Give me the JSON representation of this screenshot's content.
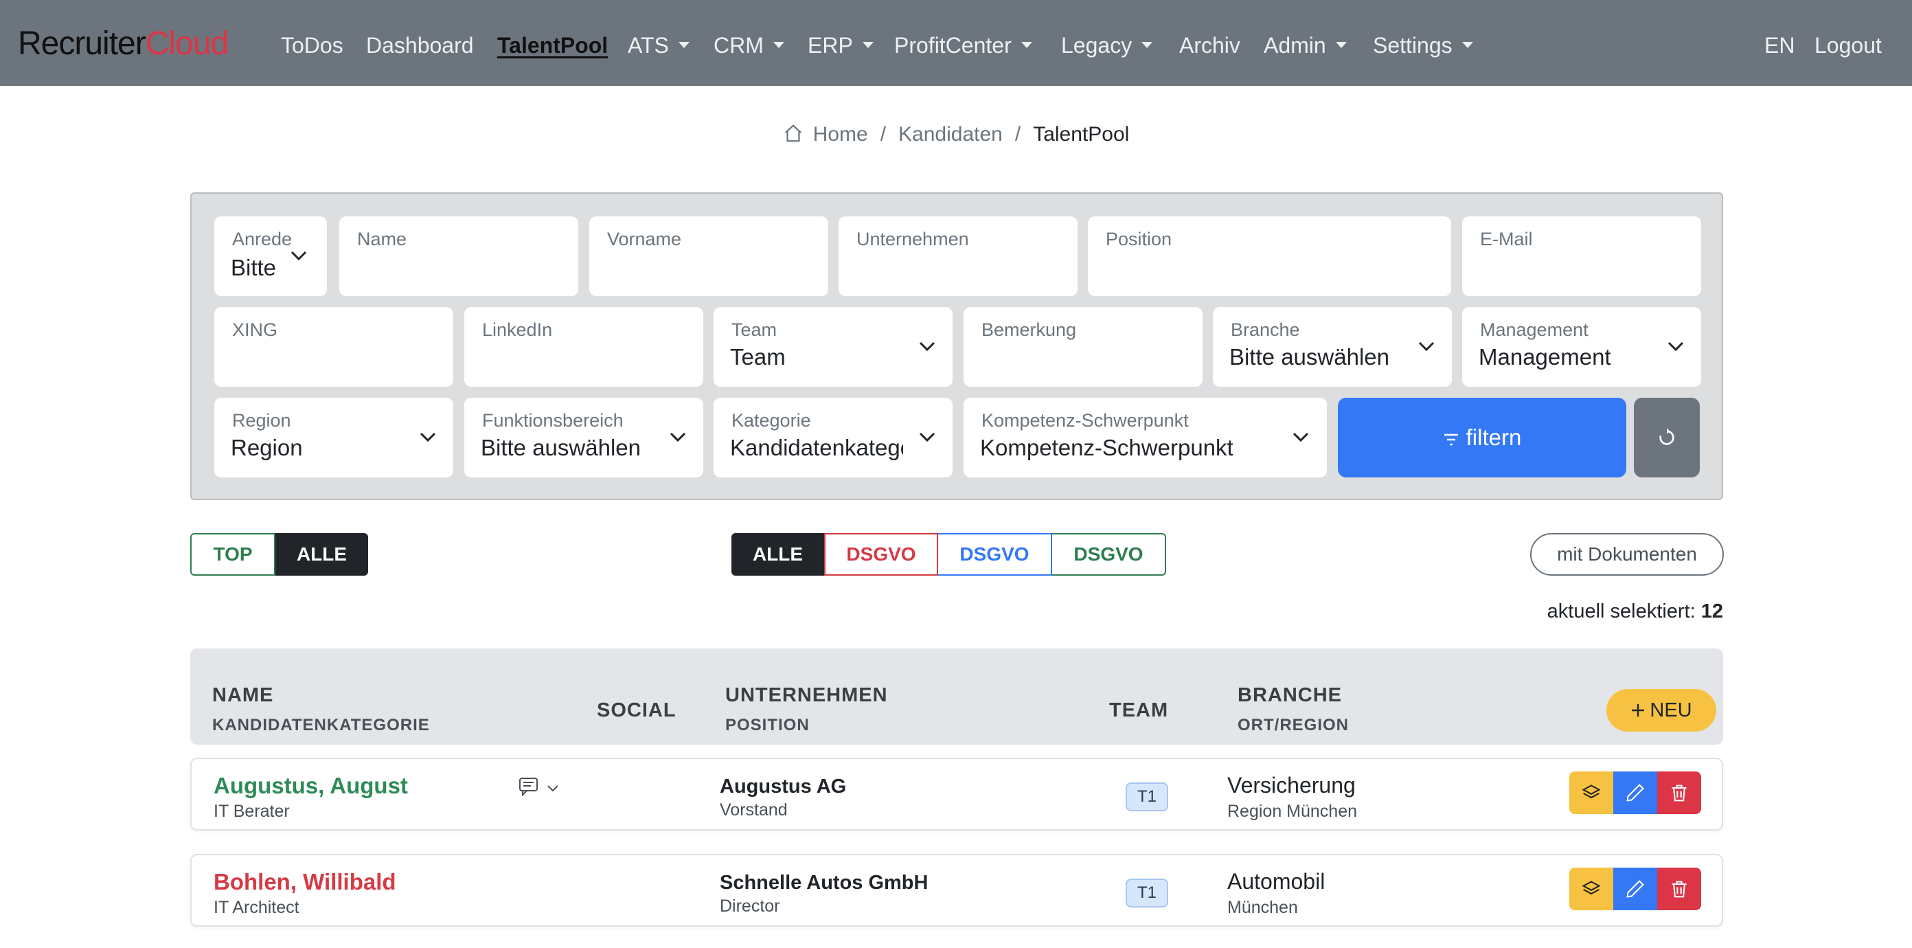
{
  "brand": {
    "part1": "Recruiter",
    "part2": "Cloud"
  },
  "nav": {
    "todos": "ToDos",
    "dashboard": "Dashboard",
    "talentpool": "TalentPool",
    "ats": "ATS",
    "crm": "CRM",
    "erp": "ERP",
    "profitcenter": "ProfitCenter",
    "legacy": "Legacy",
    "archiv": "Archiv",
    "admin": "Admin",
    "settings": "Settings",
    "lang": "EN",
    "logout": "Logout"
  },
  "breadcrumb": {
    "home": "Home",
    "kandidaten": "Kandidaten",
    "current": "TalentPool",
    "separator": "/"
  },
  "filters": {
    "anrede": {
      "label": "Anrede",
      "value": "Bitte"
    },
    "name": {
      "label": "Name",
      "value": ""
    },
    "vorname": {
      "label": "Vorname",
      "value": ""
    },
    "unternehmen": {
      "label": "Unternehmen",
      "value": ""
    },
    "position": {
      "label": "Position",
      "value": ""
    },
    "email": {
      "label": "E-Mail",
      "value": ""
    },
    "xing": {
      "label": "XING",
      "value": ""
    },
    "linkedin": {
      "label": "LinkedIn",
      "value": ""
    },
    "team": {
      "label": "Team",
      "value": "Team"
    },
    "bemerkung": {
      "label": "Bemerkung",
      "value": ""
    },
    "branche": {
      "label": "Branche",
      "value": "Bitte auswählen"
    },
    "management": {
      "label": "Management",
      "value": "Management"
    },
    "region": {
      "label": "Region",
      "value": "Region"
    },
    "funktionsbereich": {
      "label": "Funktionsbereich",
      "value": "Bitte auswählen"
    },
    "kategorie": {
      "label": "Kategorie",
      "value": "Kandidatenkategorie"
    },
    "kompetenz": {
      "label": "Kompetenz-Schwerpunkt",
      "value": "Kompetenz-Schwerpunkt"
    },
    "filter_button": "filtern"
  },
  "toggles": {
    "top": "TOP",
    "alle": "ALLE",
    "dsgvo_alle": "ALLE",
    "dsgvo_red": "DSGVO",
    "dsgvo_blue": "DSGVO",
    "dsgvo_green": "DSGVO",
    "mit_dokumenten": "mit Dokumenten"
  },
  "selection": {
    "label": "aktuell selektiert:",
    "count": "12"
  },
  "table": {
    "headers": {
      "name": "NAME",
      "kategorie": "KANDIDATENKATEGORIE",
      "social": "SOCIAL",
      "unternehmen": "UNTERNEHMEN",
      "position": "POSITION",
      "team": "TEAM",
      "branche": "BRANCHE",
      "ort": "ORT/REGION"
    },
    "new_button": "NEU",
    "rows": [
      {
        "name": "Augustus, August",
        "name_color": "#2e8b57",
        "kategorie": "IT Berater",
        "unternehmen": "Augustus AG",
        "position": "Vorstand",
        "team": "T1",
        "branche": "Versicherung",
        "ort": "Region München",
        "has_comment": true
      },
      {
        "name": "Bohlen, Willibald",
        "name_color": "#d63a45",
        "kategorie": "IT Architect",
        "unternehmen": "Schnelle Autos GmbH",
        "position": "Director",
        "team": "T1",
        "branche": "Automobil",
        "ort": "München",
        "has_comment": false
      }
    ]
  },
  "colors": {
    "navbar": "#6c757d",
    "primary": "#3478f6",
    "danger": "#dc3545",
    "warning": "#f7c241",
    "success": "#2e7d4f",
    "dark": "#212529"
  }
}
